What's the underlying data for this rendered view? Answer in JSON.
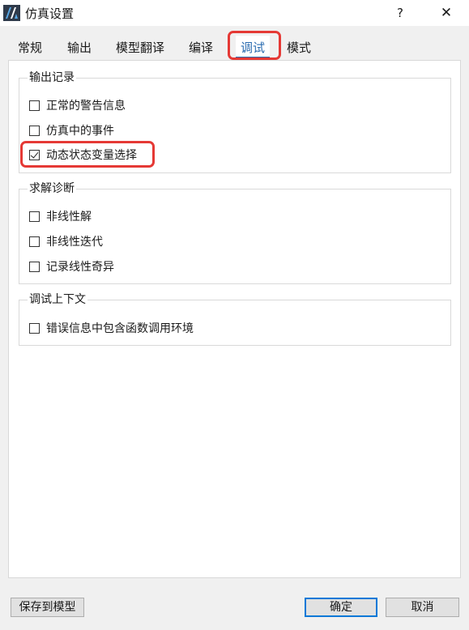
{
  "window": {
    "title": "仿真设置",
    "help_label": "?",
    "close_label": "✕"
  },
  "tabs": [
    {
      "label": "常规",
      "active": false
    },
    {
      "label": "输出",
      "active": false
    },
    {
      "label": "模型翻译",
      "active": false
    },
    {
      "label": "编译",
      "active": false
    },
    {
      "label": "调试",
      "active": true
    },
    {
      "label": "模式",
      "active": false
    }
  ],
  "groups": {
    "output_record": {
      "title": "输出记录",
      "options": [
        {
          "label": "正常的警告信息",
          "checked": false
        },
        {
          "label": "仿真中的事件",
          "checked": false
        },
        {
          "label": "动态状态变量选择",
          "checked": true
        }
      ]
    },
    "solver_diagnostics": {
      "title": "求解诊断",
      "options": [
        {
          "label": "非线性解",
          "checked": false
        },
        {
          "label": "非线性迭代",
          "checked": false
        },
        {
          "label": "记录线性奇异",
          "checked": false
        }
      ]
    },
    "debug_context": {
      "title": "调试上下文",
      "options": [
        {
          "label": "错误信息中包含函数调用环境",
          "checked": false
        }
      ]
    }
  },
  "buttons": {
    "save_to_model": "保存到模型",
    "ok": "确定",
    "cancel": "取消"
  },
  "colors": {
    "accent": "#2b6cb0",
    "highlight": "#e53935"
  }
}
